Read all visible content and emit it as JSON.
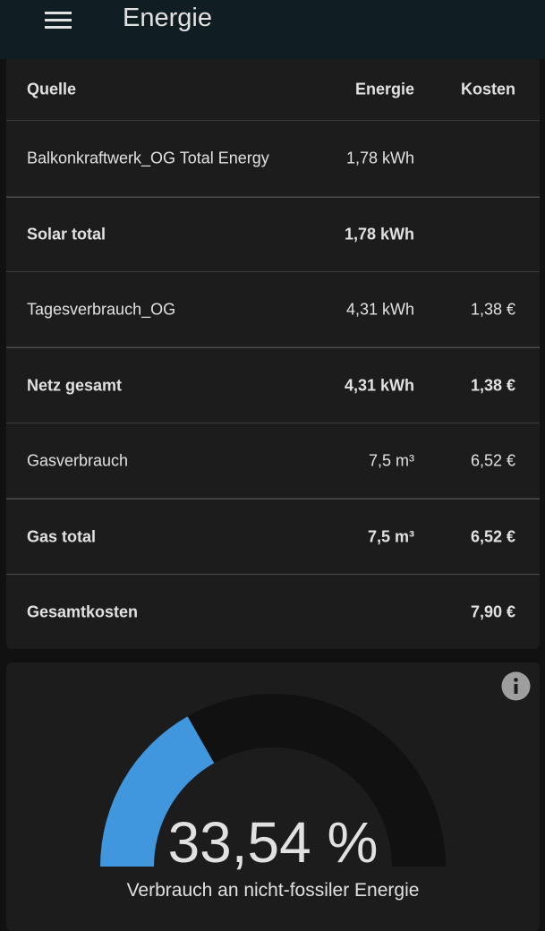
{
  "header": {
    "title": "Energie"
  },
  "table": {
    "columns": {
      "source": "Quelle",
      "energy": "Energie",
      "cost": "Kosten"
    },
    "rows": [
      {
        "source": "Balkonkraftwerk_OG Total Energy",
        "energy": "1,78 kWh",
        "cost": ""
      },
      {
        "source": "Solar total",
        "energy": "1,78 kWh",
        "cost": ""
      },
      {
        "source": "Tagesverbrauch_OG",
        "energy": "4,31 kWh",
        "cost": "1,38 €"
      },
      {
        "source": "Netz gesamt",
        "energy": "4,31 kWh",
        "cost": "1,38 €"
      },
      {
        "source": "Gasverbrauch",
        "energy": "7,5 m³",
        "cost": "6,52 €"
      },
      {
        "source": "Gas total",
        "energy": "7,5 m³",
        "cost": "6,52 €"
      },
      {
        "source": "Gesamtkosten",
        "energy": "",
        "cost": "7,90 €"
      }
    ]
  },
  "gauge": {
    "value_text": "33,54 %",
    "value": 33.54,
    "label": "Verbrauch an nicht-fossiler Energie",
    "fill_color": "#4097de",
    "track_color": "#111111"
  },
  "icons": {
    "menu": "menu-icon",
    "info": "info-icon"
  }
}
